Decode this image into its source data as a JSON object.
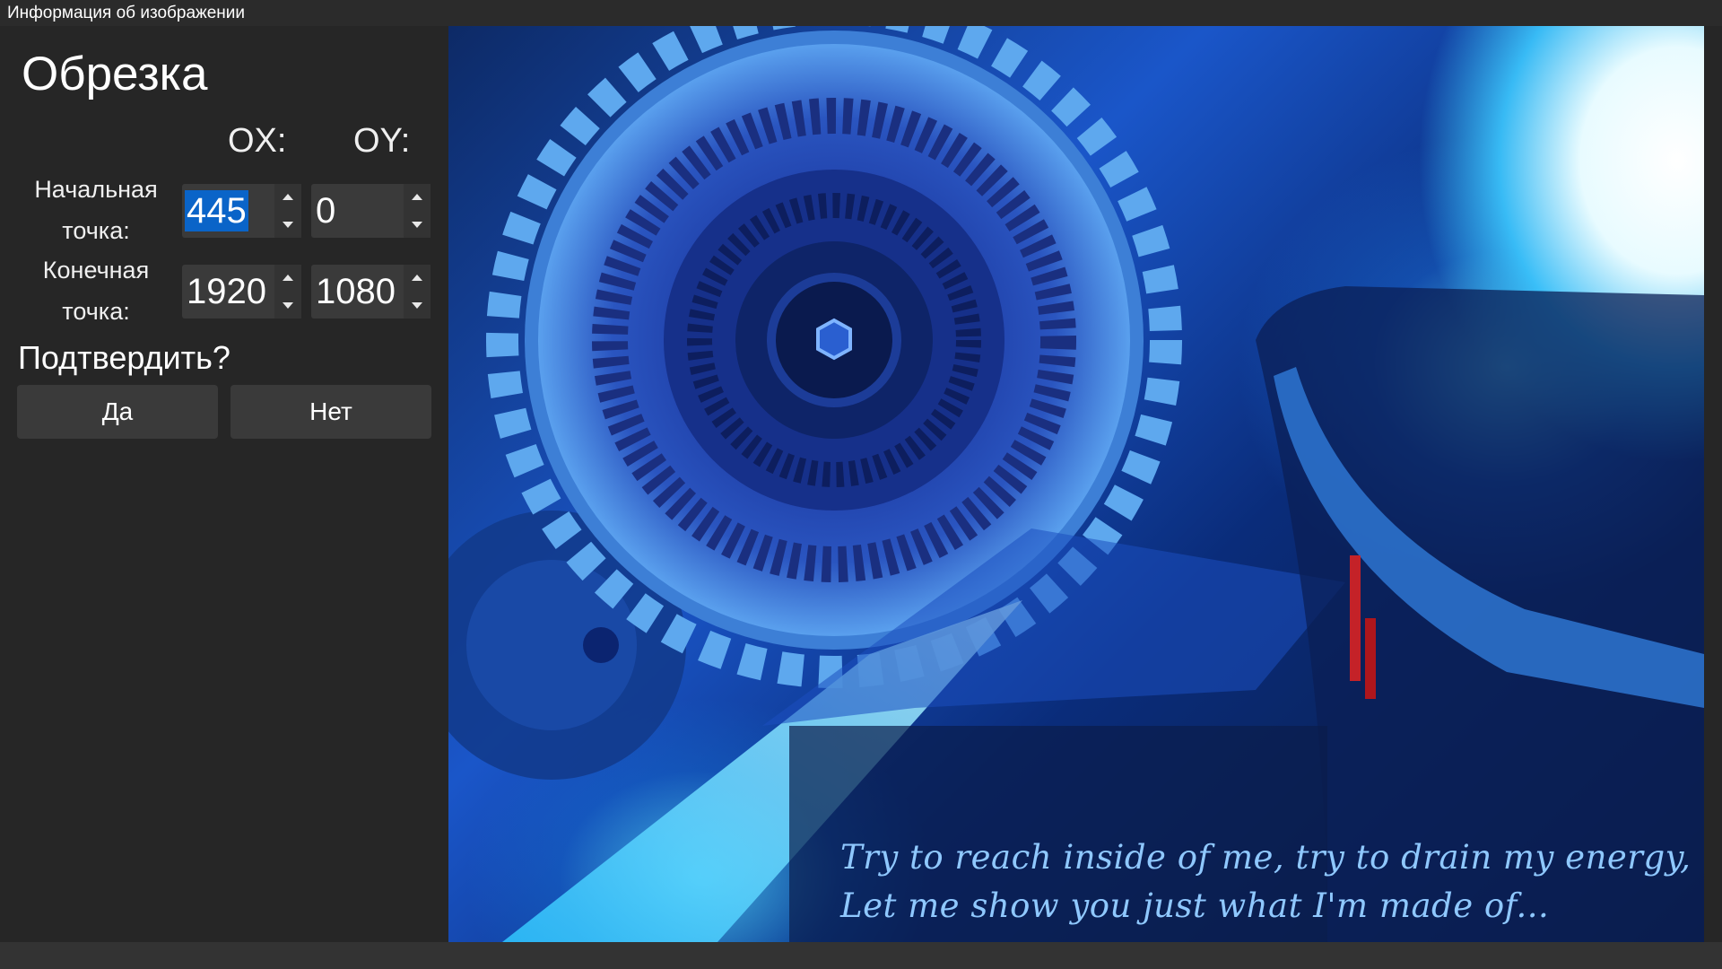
{
  "window": {
    "title": "Информация об изображении"
  },
  "crop_panel": {
    "heading": "Обрезка",
    "ox_label": "OX:",
    "oy_label": "OY:",
    "start_point": {
      "label_line1": "Начальная",
      "label_line2": "точка:",
      "x": "445",
      "y": "0"
    },
    "end_point": {
      "label_line1": "Конечная",
      "label_line2": "точка:",
      "x": "1920",
      "y": "1080"
    },
    "confirm_question": "Подтвердить?",
    "yes_label": "Да",
    "no_label": "Нет"
  },
  "image": {
    "caption_line1": "Try to reach inside of me, try to drain my energy,",
    "caption_line2": "Let me show you just what I'm made of..."
  },
  "colors": {
    "background": "#262626",
    "selection": "#0a64c8",
    "button": "#3a3a3a"
  }
}
